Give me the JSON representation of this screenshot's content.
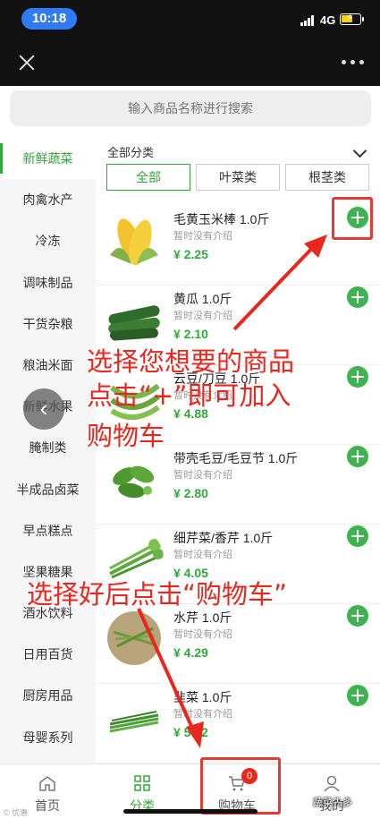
{
  "status": {
    "time": "10:18",
    "network": "4G"
  },
  "search": {
    "placeholder": "输入商品名称进行搜索"
  },
  "sidebar": {
    "items": [
      "新鲜蔬菜",
      "肉禽水产",
      "冷冻",
      "调味制品",
      "干货杂粮",
      "粮油米面",
      "新鲜水果",
      "腌制类",
      "半成品卤菜",
      "早点糕点",
      "坚果糖果",
      "酒水饮料",
      "日用百货",
      "厨房用品",
      "母婴系列"
    ]
  },
  "filter": {
    "header": "全部分类",
    "tabs": [
      "全部",
      "叶菜类",
      "根茎类"
    ]
  },
  "products": [
    {
      "name": "毛黄玉米棒 1.0斤",
      "desc": "暂时没有介绍",
      "price": "¥ 2.25"
    },
    {
      "name": "黄瓜 1.0斤",
      "desc": "暂时没有介绍",
      "price": "¥ 2.10"
    },
    {
      "name": "云豆/刀豆 1.0斤",
      "desc": "暂时没有介绍",
      "price": "¥ 4.88"
    },
    {
      "name": "带壳毛豆/毛豆节 1.0斤",
      "desc": "暂时没有介绍",
      "price": "¥ 2.80"
    },
    {
      "name": "细芹菜/香芹 1.0斤",
      "desc": "暂时没有介绍",
      "price": "¥ 4.05"
    },
    {
      "name": "水芹 1.0斤",
      "desc": "暂时没有介绍",
      "price": "¥ 4.29"
    },
    {
      "name": "韭菜 1.0斤",
      "desc": "暂时没有介绍",
      "price": "¥ 5.62"
    }
  ],
  "annotations": {
    "line1": "选择您想要的商品",
    "line2": "点击“+”即可加入",
    "line3": "购物车",
    "line4": "选择好后点击“购物车”"
  },
  "tabbar": {
    "items": [
      "首页",
      "分类",
      "购物车",
      "我的"
    ],
    "cart_count": "0"
  },
  "watermark": "蔬菜先多",
  "watermark_small": "© 优惠"
}
